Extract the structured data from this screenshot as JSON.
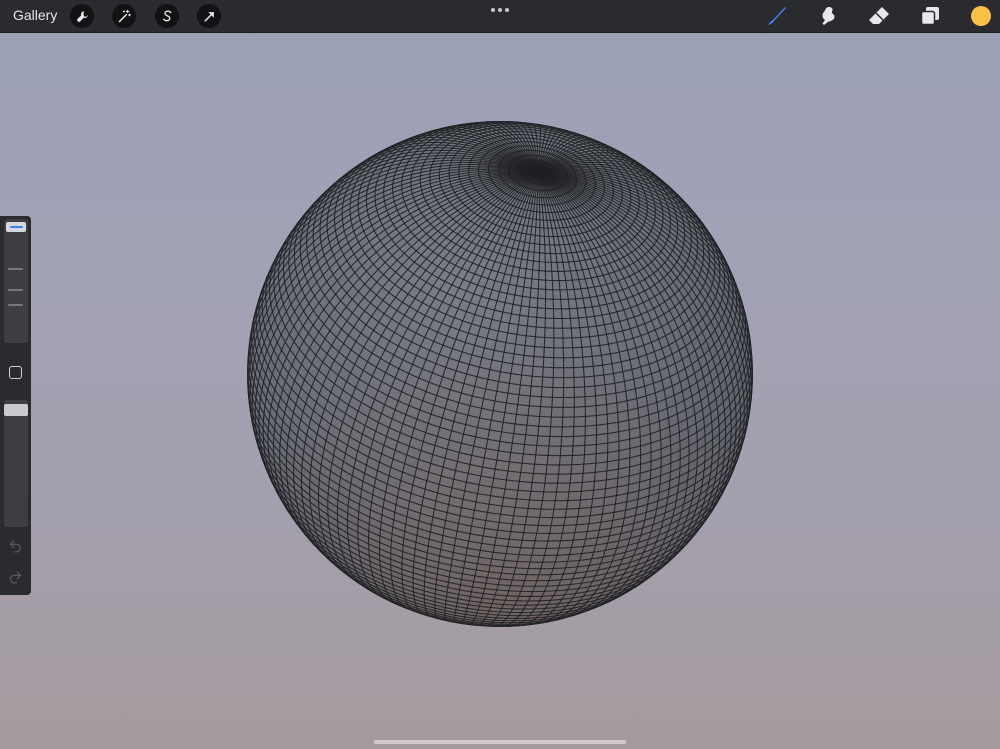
{
  "topbar": {
    "gallery_label": "Gallery",
    "left_tools": [
      {
        "name": "actions",
        "icon": "wrench-icon"
      },
      {
        "name": "adjustments",
        "icon": "magic-wand-icon"
      },
      {
        "name": "selection",
        "icon": "selection-s-icon"
      },
      {
        "name": "transform",
        "icon": "transform-arrow-icon"
      }
    ],
    "more_icon": "ellipsis-icon",
    "right_tools": [
      {
        "name": "brush",
        "icon": "brush-icon",
        "active": true
      },
      {
        "name": "smudge",
        "icon": "smudge-icon",
        "active": false
      },
      {
        "name": "eraser",
        "icon": "eraser-icon",
        "active": false
      },
      {
        "name": "layers",
        "icon": "layers-icon",
        "active": false
      }
    ],
    "current_color": "#f8c045"
  },
  "sidebar": {
    "brush_size_icon": "brush-size-slider",
    "modify_icon": "square-icon",
    "opacity_icon": "opacity-slider",
    "undo_icon": "undo-icon",
    "redo_icon": "redo-icon"
  },
  "colors": {
    "accent": "#3b82f6",
    "toolbar": "#2a2b2e",
    "sphere": "#6b6e76"
  }
}
